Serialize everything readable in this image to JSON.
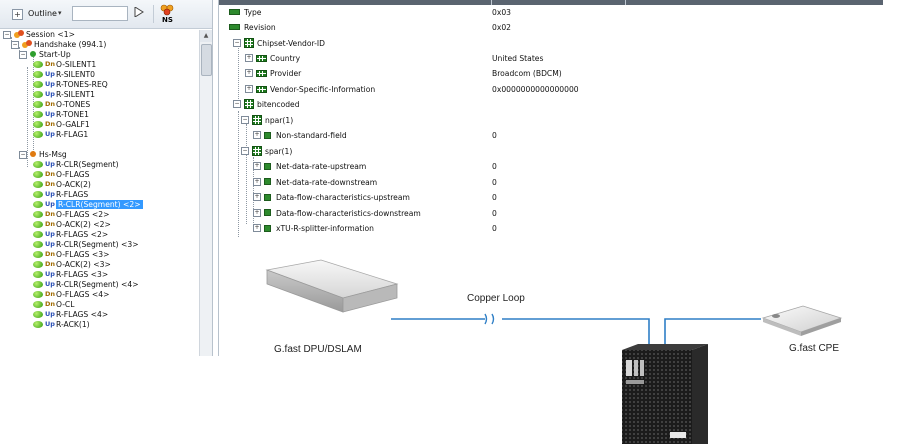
{
  "toolbar": {
    "outline_label": "Outline",
    "dropdown_icon": "chevron-down-icon",
    "play_icon": "play-icon",
    "ns_icon": "ns-flag-icon"
  },
  "tree": {
    "session": "Session <1>",
    "handshake": "Handshake (994.1)",
    "startup": "Start-Up",
    "startup_msgs": [
      {
        "dir": "Dn",
        "label": "O-SILENT1"
      },
      {
        "dir": "Up",
        "label": "R-SILENT0"
      },
      {
        "dir": "Up",
        "label": "R-TONES-REQ"
      },
      {
        "dir": "Up",
        "label": "R-SILENT1"
      },
      {
        "dir": "Dn",
        "label": "O-TONES"
      },
      {
        "dir": "Up",
        "label": "R-TONE1"
      },
      {
        "dir": "Dn",
        "label": "O-GALF1"
      },
      {
        "dir": "Up",
        "label": "R-FLAG1"
      }
    ],
    "hsmsg": "Hs-Msg",
    "hs_msgs": [
      {
        "dir": "Up",
        "label": "R-CLR(Segment)"
      },
      {
        "dir": "Dn",
        "label": "O-FLAGS"
      },
      {
        "dir": "Dn",
        "label": "O-ACK(2)"
      },
      {
        "dir": "Up",
        "label": "R-FLAGS"
      },
      {
        "dir": "Up",
        "label": "R-CLR(Segment) <2>"
      },
      {
        "dir": "Dn",
        "label": "O-FLAGS <2>"
      },
      {
        "dir": "Dn",
        "label": "O-ACK(2) <2>"
      },
      {
        "dir": "Up",
        "label": "R-FLAGS <2>"
      },
      {
        "dir": "Up",
        "label": "R-CLR(Segment) <3>"
      },
      {
        "dir": "Dn",
        "label": "O-FLAGS <3>"
      },
      {
        "dir": "Dn",
        "label": "O-ACK(2) <3>"
      },
      {
        "dir": "Up",
        "label": "R-FLAGS <3>"
      },
      {
        "dir": "Up",
        "label": "R-CLR(Segment) <4>"
      },
      {
        "dir": "Dn",
        "label": "O-FLAGS <4>"
      },
      {
        "dir": "Dn",
        "label": "O-CL"
      },
      {
        "dir": "Up",
        "label": "R-FLAGS <4>"
      },
      {
        "dir": "Up",
        "label": "R-ACK(1)"
      }
    ],
    "selected": "R-CLR(Segment) <2>"
  },
  "details": {
    "type_label": "Type",
    "type_value": "0x03",
    "revision_label": "Revision",
    "revision_value": "0x02",
    "chipset_label": "Chipset-Vendor-ID",
    "country_label": "Country",
    "country_value": "United States",
    "provider_label": "Provider",
    "provider_value": "Broadcom (BDCM)",
    "vendor_specific_label": "Vendor-Specific-Information",
    "vendor_specific_value": "0x0000000000000000",
    "bitencoded_label": "bitencoded",
    "npar_label": "npar(1)",
    "nonstandard_label": "Non-standard-field",
    "nonstandard_value": "0",
    "spar_label": "spar(1)",
    "spar_fields": [
      {
        "label": "Net-data-rate-upstream",
        "value": "0"
      },
      {
        "label": "Net-data-rate-downstream",
        "value": "0"
      },
      {
        "label": "Data-flow-characteristics-upstream",
        "value": "0"
      },
      {
        "label": "Data-flow-characteristics-downstream",
        "value": "0"
      },
      {
        "label": "xTU-R-splitter-information",
        "value": "0"
      }
    ]
  },
  "diagram": {
    "dpu_label": "G.fast DPU/DSLAM",
    "loop_label": "Copper Loop",
    "cpe_label": "G.fast CPE",
    "line_color": "#2f7fc6"
  }
}
